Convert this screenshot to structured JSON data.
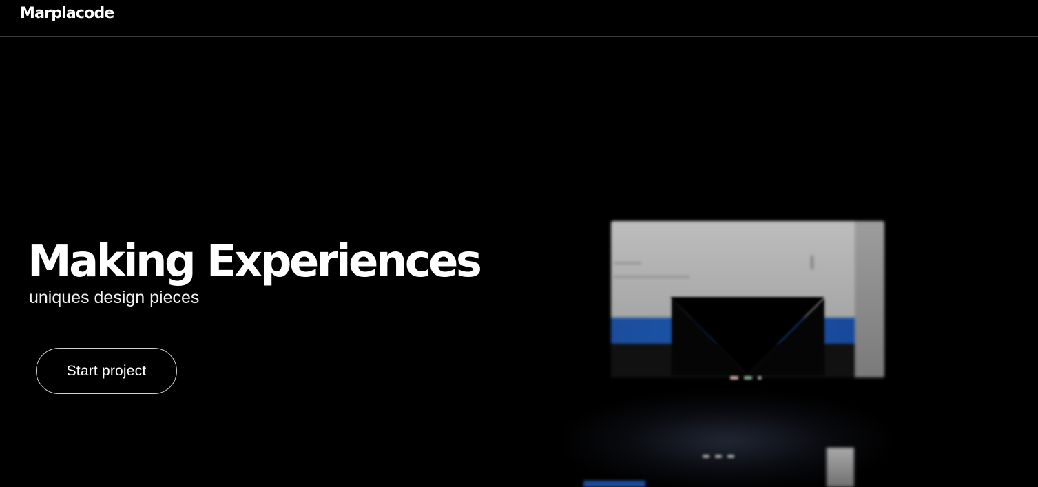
{
  "header": {
    "logo_text": "Marplacode"
  },
  "hero": {
    "title": "Making Experiences",
    "subtitle": "uniques design pieces",
    "cta_label": "Start project"
  },
  "visual": {
    "description_icon": "m-logo-mockup-icon",
    "colors": {
      "screen": "#b4b4b4",
      "accent_blue": "#1a56ad",
      "dark_band": "#111111",
      "background": "#000000"
    }
  }
}
